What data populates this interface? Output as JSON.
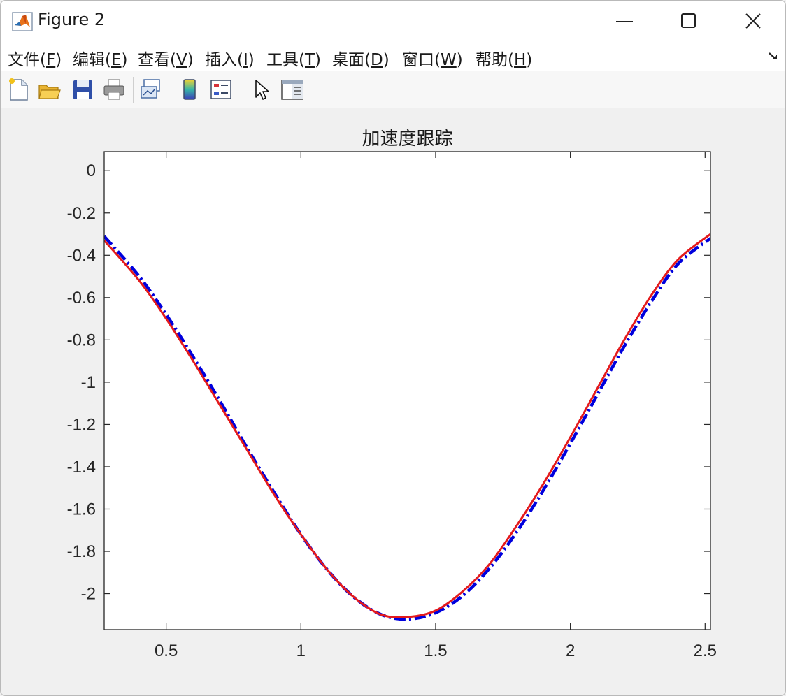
{
  "window": {
    "title": "Figure 2",
    "minimize_icon": "minimize-icon",
    "maximize_icon": "maximize-icon",
    "close_icon": "close-icon"
  },
  "menu": {
    "items": [
      {
        "label": "文件(",
        "key": "F",
        "suffix": ")"
      },
      {
        "label": "编辑(",
        "key": "E",
        "suffix": ")"
      },
      {
        "label": "查看(",
        "key": "V",
        "suffix": ")"
      },
      {
        "label": "插入(",
        "key": "I",
        "suffix": ")"
      },
      {
        "label": "工具(",
        "key": "T",
        "suffix": ")"
      },
      {
        "label": "桌面(",
        "key": "D",
        "suffix": ")"
      },
      {
        "label": "窗口(",
        "key": "W",
        "suffix": ")"
      },
      {
        "label": "帮助(",
        "key": "H",
        "suffix": ")"
      }
    ]
  },
  "toolbar": {
    "buttons": [
      "new-figure-icon",
      "open-file-icon",
      "save-icon",
      "print-icon",
      "link-plot-icon",
      "colorbar-icon",
      "legend-icon",
      "pointer-icon",
      "property-inspector-icon"
    ]
  },
  "colors": {
    "series_red": "#e41a1c",
    "series_blue": "#0000dd",
    "axes_bg": "#ffffff",
    "figure_bg": "#f0f0f0"
  },
  "chart_data": {
    "type": "line",
    "title": "加速度跟踪",
    "xlabel": "",
    "ylabel": "",
    "xlim": [
      0.27,
      2.52
    ],
    "ylim": [
      -2.17,
      0.09
    ],
    "xticks": [
      0.5,
      1,
      1.5,
      2,
      2.5
    ],
    "xtick_labels": [
      "0.5",
      "1",
      "1.5",
      "2",
      "2.5"
    ],
    "yticks": [
      0,
      -0.2,
      -0.4,
      -0.6,
      -0.8,
      -1,
      -1.2,
      -1.4,
      -1.6,
      -1.8,
      -2
    ],
    "ytick_labels": [
      "0",
      "-0.2",
      "-0.4",
      "-0.6",
      "-0.8",
      "-1",
      "-1.2",
      "-1.4",
      "-1.6",
      "-1.8",
      "-2"
    ],
    "grid": false,
    "legend": "none",
    "series": [
      {
        "color": "#0000dd",
        "style": "dash-dot",
        "x": [
          0.27,
          0.4,
          0.5,
          0.6,
          0.7,
          0.8,
          0.9,
          1.0,
          1.1,
          1.2,
          1.3,
          1.4,
          1.5,
          1.6,
          1.7,
          1.8,
          1.9,
          2.0,
          2.1,
          2.2,
          2.3,
          2.4,
          2.52
        ],
        "y": [
          -0.31,
          -0.5,
          -0.68,
          -0.88,
          -1.09,
          -1.31,
          -1.52,
          -1.72,
          -1.89,
          -2.02,
          -2.1,
          -2.12,
          -2.09,
          -2.01,
          -1.88,
          -1.71,
          -1.51,
          -1.29,
          -1.06,
          -0.83,
          -0.62,
          -0.44,
          -0.32
        ]
      },
      {
        "color": "#e41a1c",
        "style": "solid",
        "x": [
          0.27,
          0.4,
          0.5,
          0.6,
          0.7,
          0.8,
          0.9,
          1.0,
          1.1,
          1.2,
          1.3,
          1.4,
          1.5,
          1.6,
          1.7,
          1.8,
          1.9,
          2.0,
          2.1,
          2.2,
          2.3,
          2.4,
          2.52
        ],
        "y": [
          -0.33,
          -0.52,
          -0.7,
          -0.9,
          -1.11,
          -1.32,
          -1.53,
          -1.72,
          -1.89,
          -2.02,
          -2.1,
          -2.11,
          -2.08,
          -1.99,
          -1.86,
          -1.68,
          -1.48,
          -1.26,
          -1.03,
          -0.8,
          -0.59,
          -0.42,
          -0.3
        ]
      }
    ]
  }
}
